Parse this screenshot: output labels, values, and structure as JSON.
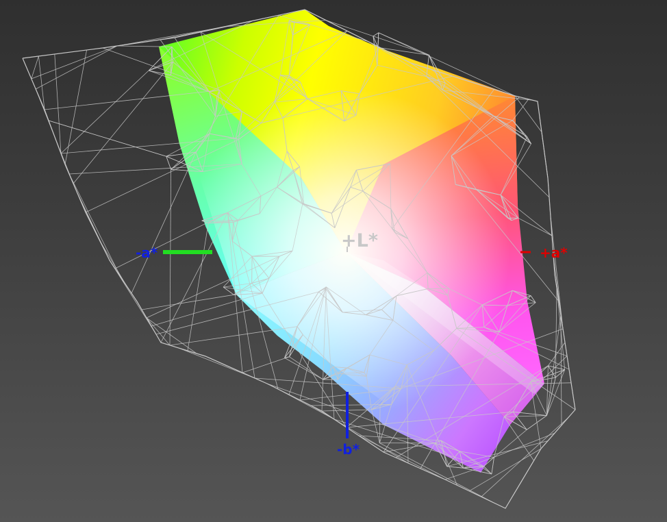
{
  "axes": {
    "l_label": "+L*",
    "a_pos_label": "+a*",
    "a_neg_label": "-a*",
    "b_neg_label": "-b*"
  },
  "colors": {
    "background_top": "#2f2f2f",
    "background_bottom": "#555555",
    "wireframe": "#c8c8c8",
    "l_axis": "#c8c8c8",
    "a_pos_axis": "#e00000",
    "a_neg_axis": "#22dd22",
    "b_neg_axis": "#1020e0"
  },
  "solid_colors": {
    "yellow": "#ffff00",
    "green": "#33ff33",
    "orange": "#ff8800",
    "red": "#ff3355",
    "magenta": "#ff44ff",
    "violet": "#aa55ff",
    "blue": "#7799ff",
    "cyan": "#55ffff",
    "white": "#fffff5"
  }
}
